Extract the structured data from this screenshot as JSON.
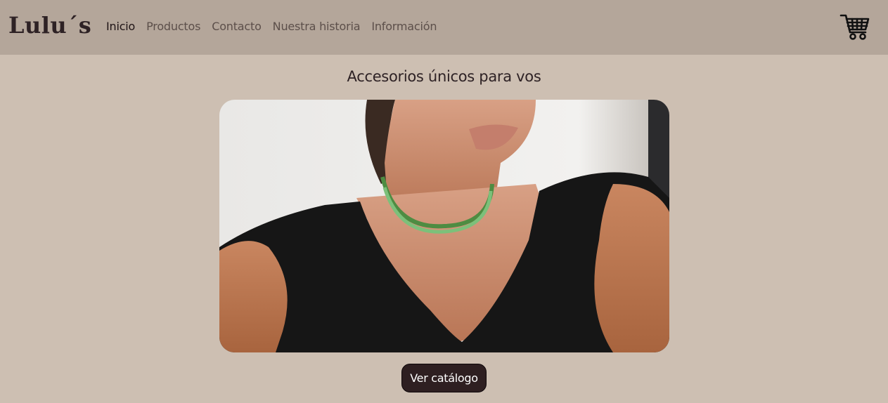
{
  "navbar": {
    "brand": "Lulu´s",
    "links": [
      {
        "label": "Inicio",
        "active": true
      },
      {
        "label": "Productos",
        "active": false
      },
      {
        "label": "Contacto",
        "active": false
      },
      {
        "label": "Nuestra historia",
        "active": false
      },
      {
        "label": "Información",
        "active": false
      }
    ],
    "cart_icon": "shopping-cart-icon"
  },
  "hero": {
    "title": "Accesorios únicos para vos",
    "button_label": "Ver catálogo"
  },
  "colors": {
    "background": "#cdbfb2",
    "navbar": "#b4a69a",
    "text": "#2e2225",
    "button": "#2e1f21"
  }
}
